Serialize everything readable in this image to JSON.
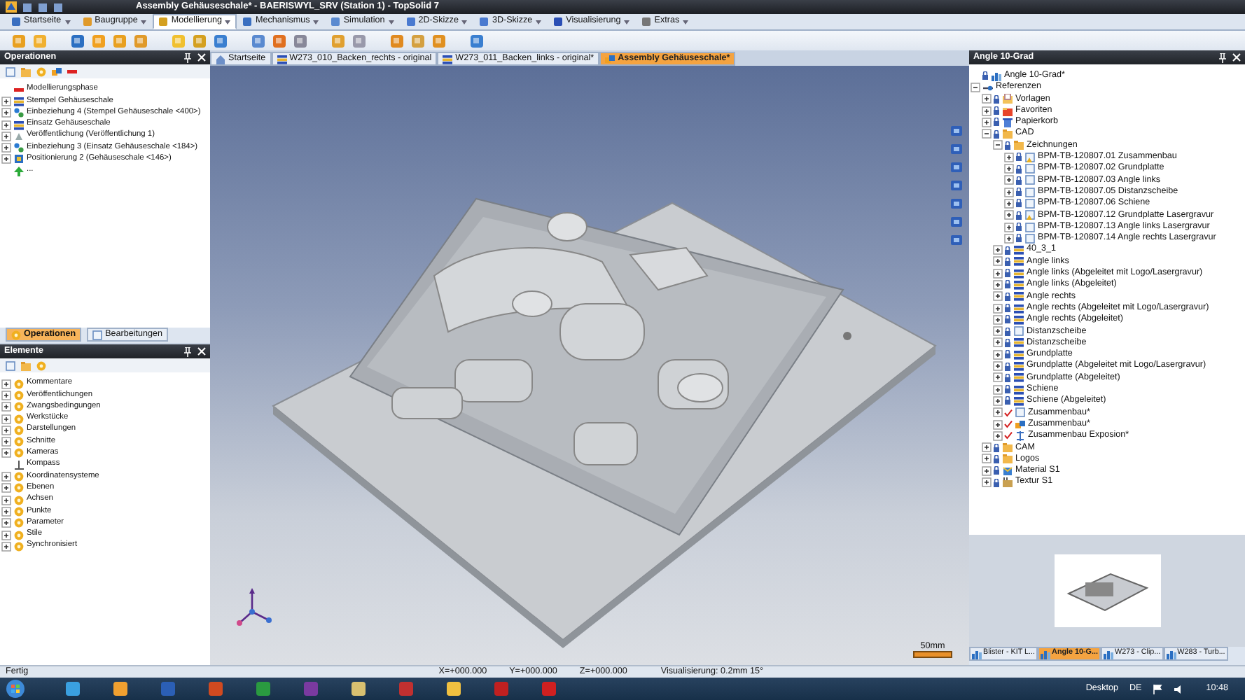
{
  "window": {
    "title": "Assembly Gehäuseschale* - BAERISWYL_SRV (Station 1) - TopSolid 7"
  },
  "ribbon_tabs": [
    {
      "label": "Startseite",
      "selected": false
    },
    {
      "label": "Baugruppe",
      "selected": false
    },
    {
      "label": "Modellierung",
      "selected": true
    },
    {
      "label": "Mechanismus",
      "selected": false
    },
    {
      "label": "Simulation",
      "selected": false
    },
    {
      "label": "2D-Skizze",
      "selected": false
    },
    {
      "label": "3D-Skizze",
      "selected": false
    },
    {
      "label": "Visualisierung",
      "selected": false
    },
    {
      "label": "Extras",
      "selected": false
    }
  ],
  "operations_panel": {
    "title": "Operationen",
    "items": [
      {
        "label": "Modellierungsphase",
        "kind": "phase"
      },
      {
        "label": "Stempel Gehäuseschale",
        "kind": "part",
        "expanded": false
      },
      {
        "label": "Einbeziehung 4 (Stempel Gehäuseschale <400>)",
        "kind": "inclusion",
        "expanded": false
      },
      {
        "label": "Einsatz Gehäuseschale",
        "kind": "part",
        "expanded": false
      },
      {
        "label": "Veröffentlichung (Veröffentlichung 1)",
        "kind": "publication",
        "expanded": false
      },
      {
        "label": "Einbeziehung 3 (Einsatz Gehäuseschale <184>)",
        "kind": "inclusion",
        "expanded": false
      },
      {
        "label": "Positionierung 2 (Gehäuseschale <146>)",
        "kind": "positioning",
        "expanded": false
      },
      {
        "label": "...",
        "kind": "end"
      }
    ],
    "tabs": [
      {
        "label": "Operationen",
        "selected": true
      },
      {
        "label": "Bearbeitungen",
        "selected": false
      }
    ]
  },
  "elements_panel": {
    "title": "Elemente",
    "items": [
      {
        "label": "Kommentare",
        "kind": "group",
        "expanded": false
      },
      {
        "label": "Veröffentlichungen",
        "kind": "group",
        "expanded": false
      },
      {
        "label": "Zwangsbedingungen",
        "kind": "group",
        "expanded": false
      },
      {
        "label": "Werkstücke",
        "kind": "group",
        "expanded": false
      },
      {
        "label": "Darstellungen",
        "kind": "group",
        "expanded": false
      },
      {
        "label": "Schnitte",
        "kind": "group",
        "expanded": false
      },
      {
        "label": "Kameras",
        "kind": "group",
        "expanded": false
      },
      {
        "label": "Kompass",
        "kind": "compass"
      },
      {
        "label": "Koordinatensysteme",
        "kind": "group",
        "expanded": false
      },
      {
        "label": "Ebenen",
        "kind": "group",
        "expanded": false
      },
      {
        "label": "Achsen",
        "kind": "group",
        "expanded": false
      },
      {
        "label": "Punkte",
        "kind": "group",
        "expanded": false
      },
      {
        "label": "Parameter",
        "kind": "group",
        "expanded": false
      },
      {
        "label": "Stile",
        "kind": "group",
        "expanded": false
      },
      {
        "label": "Synchronisiert",
        "kind": "group",
        "expanded": false
      }
    ]
  },
  "document_tabs": [
    {
      "label": "Startseite",
      "kind": "home",
      "selected": false
    },
    {
      "label": "W273_010_Backen_rechts - original",
      "kind": "part",
      "selected": false
    },
    {
      "label": "W273_011_Backen_links - original*",
      "kind": "part",
      "selected": false
    },
    {
      "label": "Assembly Gehäuseschale*",
      "kind": "assembly",
      "selected": true
    }
  ],
  "viewport": {
    "scale_label": "50mm"
  },
  "project_panel": {
    "title": "Angle 10-Grad",
    "items": [
      {
        "label": "Angle 10-Grad*",
        "kind": "project",
        "locked": true
      },
      {
        "label": "Referenzen",
        "kind": "references",
        "expanded": true,
        "children": [
          {
            "label": "Vorlagen",
            "kind": "templates",
            "locked": true,
            "expanded": false
          },
          {
            "label": "Favoriten",
            "kind": "favorites",
            "locked": true,
            "expanded": false
          },
          {
            "label": "Papierkorb",
            "kind": "trash",
            "locked": true,
            "expanded": false
          },
          {
            "label": "CAD",
            "kind": "folder",
            "locked": true,
            "expanded": true,
            "children": [
              {
                "label": "Zeichnungen",
                "kind": "folder",
                "locked": true,
                "expanded": true,
                "children": [
                  {
                    "label": "BPM-TB-120807.01 Zusammenbau",
                    "kind": "drawing_warn",
                    "locked": true,
                    "expanded": false
                  },
                  {
                    "label": "BPM-TB-120807.02 Grundplatte",
                    "kind": "drawing",
                    "locked": true,
                    "expanded": false
                  },
                  {
                    "label": "BPM-TB-120807.03 Angle links",
                    "kind": "drawing",
                    "locked": true,
                    "expanded": false
                  },
                  {
                    "label": "BPM-TB-120807.05 Distanzscheibe",
                    "kind": "drawing",
                    "locked": true,
                    "expanded": false
                  },
                  {
                    "label": "BPM-TB-120807.06 Schiene",
                    "kind": "drawing",
                    "locked": true,
                    "expanded": false
                  },
                  {
                    "label": "BPM-TB-120807.12 Grundplatte Lasergravur",
                    "kind": "drawing_warn",
                    "locked": true,
                    "expanded": false
                  },
                  {
                    "label": "BPM-TB-120807.13 Angle links Lasergravur",
                    "kind": "drawing",
                    "locked": true,
                    "expanded": false
                  },
                  {
                    "label": "BPM-TB-120807.14 Angle rechts Lasergravur",
                    "kind": "drawing",
                    "locked": true,
                    "expanded": false
                  }
                ]
              },
              {
                "label": "40_3_1",
                "kind": "part",
                "locked": true,
                "expanded": false
              },
              {
                "label": "Angle links",
                "kind": "part",
                "locked": true,
                "expanded": false
              },
              {
                "label": "Angle links (Abgeleitet mit Logo/Lasergravur)",
                "kind": "part",
                "locked": true,
                "expanded": false
              },
              {
                "label": "Angle links (Abgeleitet)",
                "kind": "part",
                "locked": true,
                "expanded": false
              },
              {
                "label": "Angle rechts",
                "kind": "part",
                "locked": true,
                "expanded": false
              },
              {
                "label": "Angle rechts (Abgeleitet mit Logo/Lasergravur)",
                "kind": "part",
                "locked": true,
                "expanded": false
              },
              {
                "label": "Angle rechts (Abgeleitet)",
                "kind": "part",
                "locked": true,
                "expanded": false
              },
              {
                "label": "Distanzscheibe",
                "kind": "drawing",
                "locked": true,
                "expanded": false
              },
              {
                "label": "Distanzscheibe",
                "kind": "part",
                "locked": true,
                "expanded": false
              },
              {
                "label": "Grundplatte",
                "kind": "part",
                "locked": true,
                "expanded": false
              },
              {
                "label": "Grundplatte (Abgeleitet mit Logo/Lasergravur)",
                "kind": "part",
                "locked": true,
                "expanded": false
              },
              {
                "label": "Grundplatte (Abgeleitet)",
                "kind": "part",
                "locked": true,
                "expanded": false
              },
              {
                "label": "Schiene",
                "kind": "part",
                "locked": true,
                "expanded": false
              },
              {
                "label": "Schiene (Abgeleitet)",
                "kind": "part",
                "locked": true,
                "expanded": false
              },
              {
                "label": "Zusammenbau*",
                "kind": "drawing",
                "modified": true,
                "expanded": false
              },
              {
                "label": "Zusammenbau*",
                "kind": "assembly",
                "modified": true,
                "expanded": false
              },
              {
                "label": "Zusammenbau Exposion*",
                "kind": "explosion",
                "modified": true,
                "expanded": false
              }
            ]
          },
          {
            "label": "CAM",
            "kind": "folder",
            "locked": true,
            "expanded": false
          },
          {
            "label": "Logos",
            "kind": "folder",
            "locked": true,
            "expanded": false
          },
          {
            "label": "Material S1",
            "kind": "material",
            "locked": true,
            "expanded": false
          },
          {
            "label": "Textur S1",
            "kind": "texture",
            "locked": true,
            "expanded": false
          }
        ]
      }
    ],
    "tabs": [
      {
        "label": "Blister - KIT L...",
        "selected": false
      },
      {
        "label": "Angle 10-G...",
        "selected": true
      },
      {
        "label": "W273 - Clip...",
        "selected": false
      },
      {
        "label": "W283 - Turb...",
        "selected": false
      }
    ]
  },
  "status_bar": {
    "message": "Fertig",
    "x": "X=+000.000",
    "y": "Y=+000.000",
    "z": "Z=+000.000",
    "visualization": "Visualisierung: 0.2mm 15°"
  },
  "taskbar": {
    "desktop": "Desktop",
    "language": "DE",
    "time": "10:48"
  }
}
